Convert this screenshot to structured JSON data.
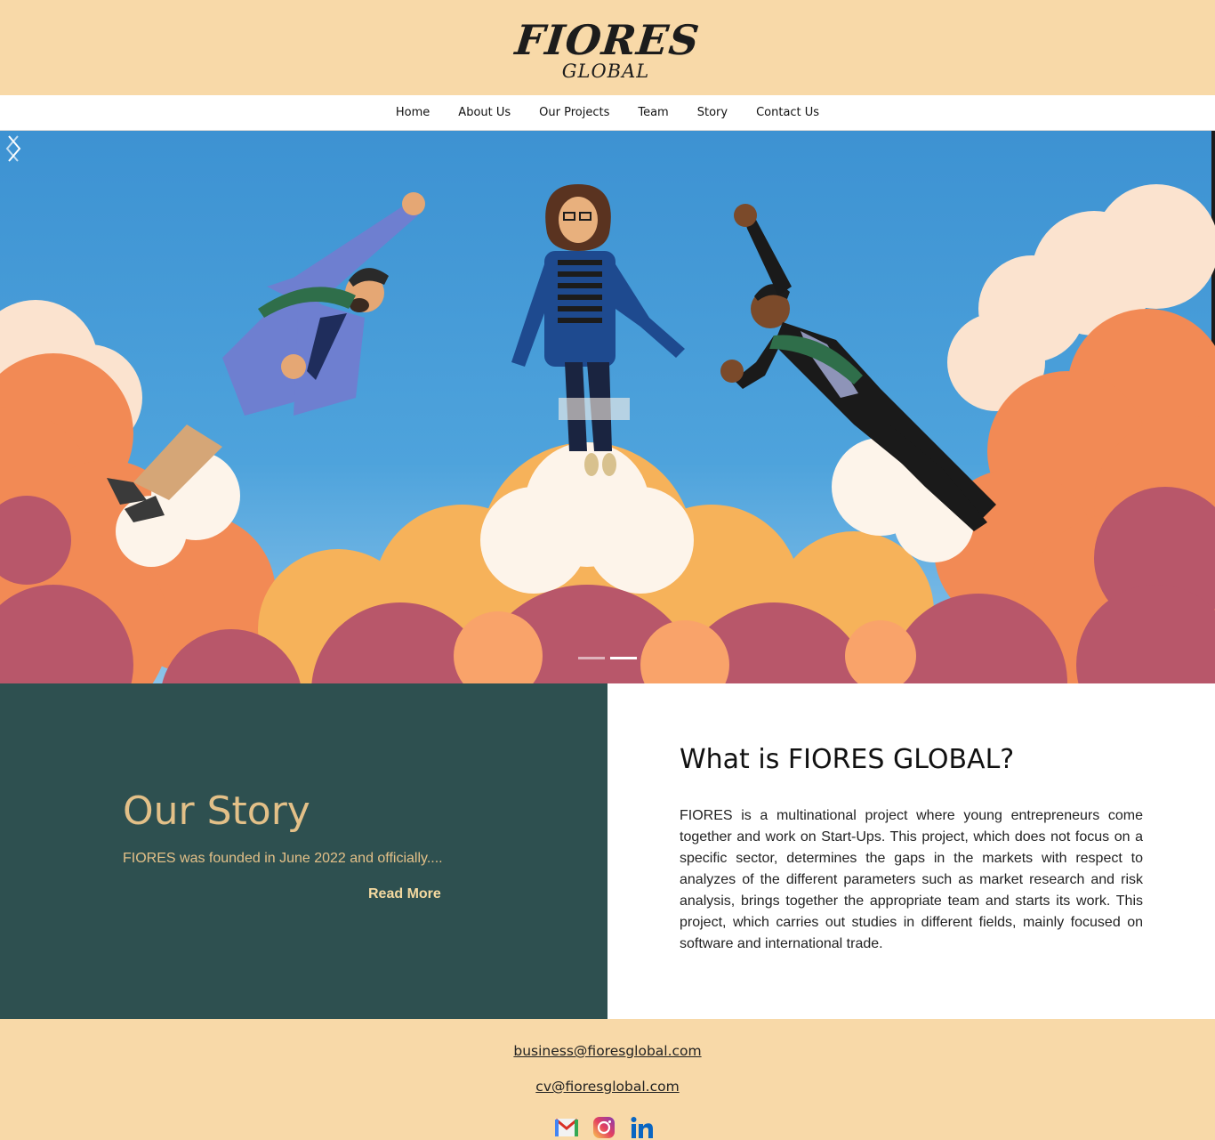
{
  "brand": {
    "name": "FIORES",
    "tagline": "GLOBAL"
  },
  "nav": {
    "items": [
      {
        "label": "Home"
      },
      {
        "label": "About Us"
      },
      {
        "label": "Our Projects"
      },
      {
        "label": "Team"
      },
      {
        "label": "Story"
      },
      {
        "label": "Contact Us"
      }
    ]
  },
  "hero": {
    "slide_count": 2,
    "active_slide": 2,
    "icons": {
      "prev": "chevron-left-icon",
      "next": "chevron-right-icon"
    }
  },
  "story": {
    "title": "Our Story",
    "excerpt": "FIORES was founded in June 2022 and officially....",
    "read_more": "Read More"
  },
  "about": {
    "title": "What is FIORES GLOBAL?",
    "body": "FIORES is a multinational project where young entrepreneurs come together and work on Start-Ups. This project, which does not focus on a specific sector, determines the gaps in the markets with respect to analyzes of the different parameters such as market research and risk analysis, brings together the appropriate team and starts its work. This project, which carries out studies in different fields, mainly focused on software and international trade."
  },
  "footer": {
    "email_business": "business@fioresglobal.com",
    "email_cv": "cv@fioresglobal.com",
    "social_icons": [
      "gmail-icon",
      "instagram-icon",
      "linkedin-icon"
    ]
  },
  "colors": {
    "header_bg": "#f8d9a8",
    "story_bg": "#2e5050",
    "story_accent": "#e3c088",
    "sky": "#3f97d4"
  }
}
